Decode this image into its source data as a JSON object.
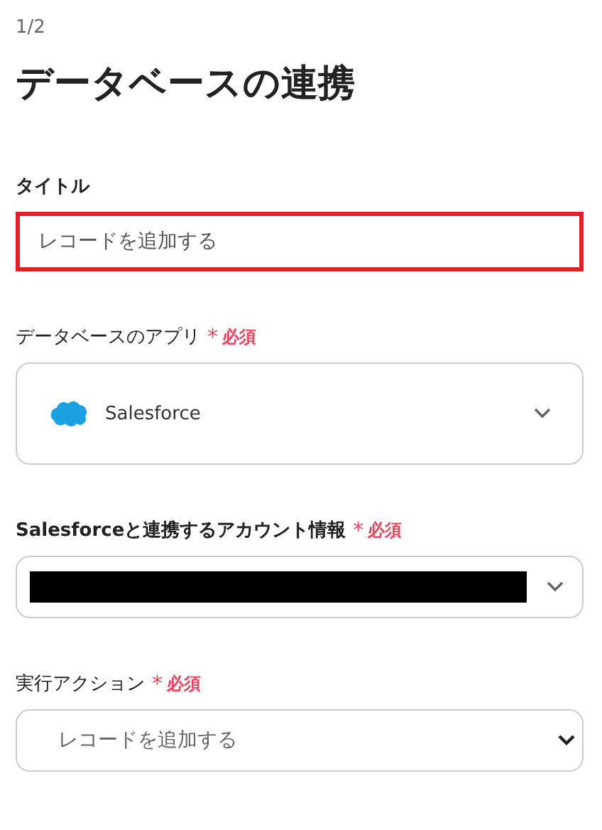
{
  "step": "1/2",
  "heading": "データベースの連携",
  "fields": [
    {
      "kind": "text",
      "label": "タイトル",
      "value": "レコードを追加する",
      "highlighted": true
    },
    {
      "kind": "app-select",
      "label": "データベースのアプリ",
      "required": {
        "mark": "*",
        "text": "必須"
      },
      "value": "Salesforce"
    },
    {
      "kind": "redacted-select",
      "label": "Salesforceと連携するアカウント情報",
      "required": {
        "mark": "*",
        "text": "必須"
      }
    },
    {
      "kind": "select",
      "label": "実行アクション",
      "required": {
        "mark": "*",
        "text": "必須"
      },
      "value": "レコードを追加する"
    }
  ]
}
